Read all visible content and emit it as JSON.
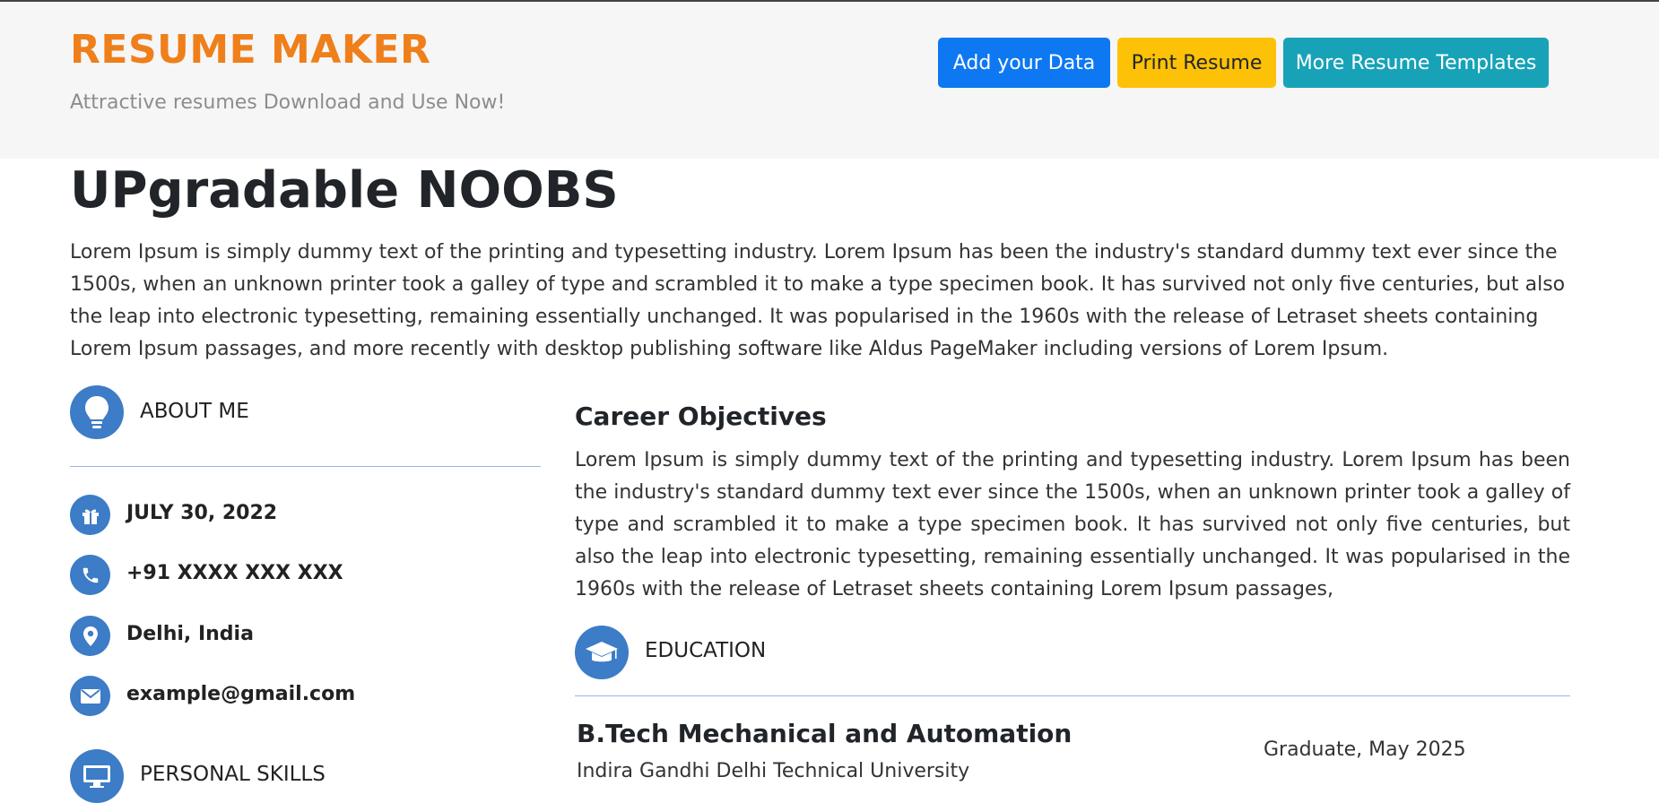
{
  "header": {
    "brand": "RESUME MAKER",
    "tagline": "Attractive resumes Download and Use Now!",
    "buttons": {
      "add": "Add your Data",
      "print": "Print Resume",
      "more": "More Resume Templates"
    }
  },
  "profile": {
    "name": "UPgradable NOOBS",
    "intro": "Lorem Ipsum is simply dummy text of the printing and typesetting industry. Lorem Ipsum has been the industry's standard dummy text ever since the 1500s, when an unknown printer took a galley of type and scrambled it to make a type specimen book. It has survived not only five centuries, but also the leap into electronic typesetting, remaining essentially unchanged. It was popularised in the 1960s with the release of Letraset sheets containing Lorem Ipsum passages, and more recently with desktop publishing software like Aldus PageMaker including versions of Lorem Ipsum."
  },
  "sidebar": {
    "about_heading": "ABOUT ME",
    "birthday": "JULY 30, 2022",
    "phone": "+91 XXXX XXX XXX",
    "location": "Delhi, India",
    "email": "example@gmail.com",
    "skills_heading": "PERSONAL SKILLS"
  },
  "main": {
    "objectives_title": "Career Objectives",
    "objectives_text": "Lorem Ipsum is simply dummy text of the printing and typesetting industry. Lorem Ipsum has been the industry's standard dummy text ever since the 1500s, when an unknown printer took a galley of type and scrambled it to make a type specimen book. It has survived not only five centuries, but also the leap into electronic typesetting, remaining essentially unchanged. It was popularised in the 1960s with the release of Letraset sheets containing Lorem Ipsum passages,",
    "education_heading": "EDUCATION",
    "education": {
      "degree": "B.Tech Mechanical and Automation",
      "university": "Indira Gandhi Delhi Technical University",
      "graduation": "Graduate, May 2025"
    }
  },
  "colors": {
    "brand": "#ef7f1a",
    "icon_bg": "#3d7cc6",
    "btn_primary": "#0d78f2",
    "btn_warning": "#fdc107",
    "btn_info": "#17a2b8"
  }
}
